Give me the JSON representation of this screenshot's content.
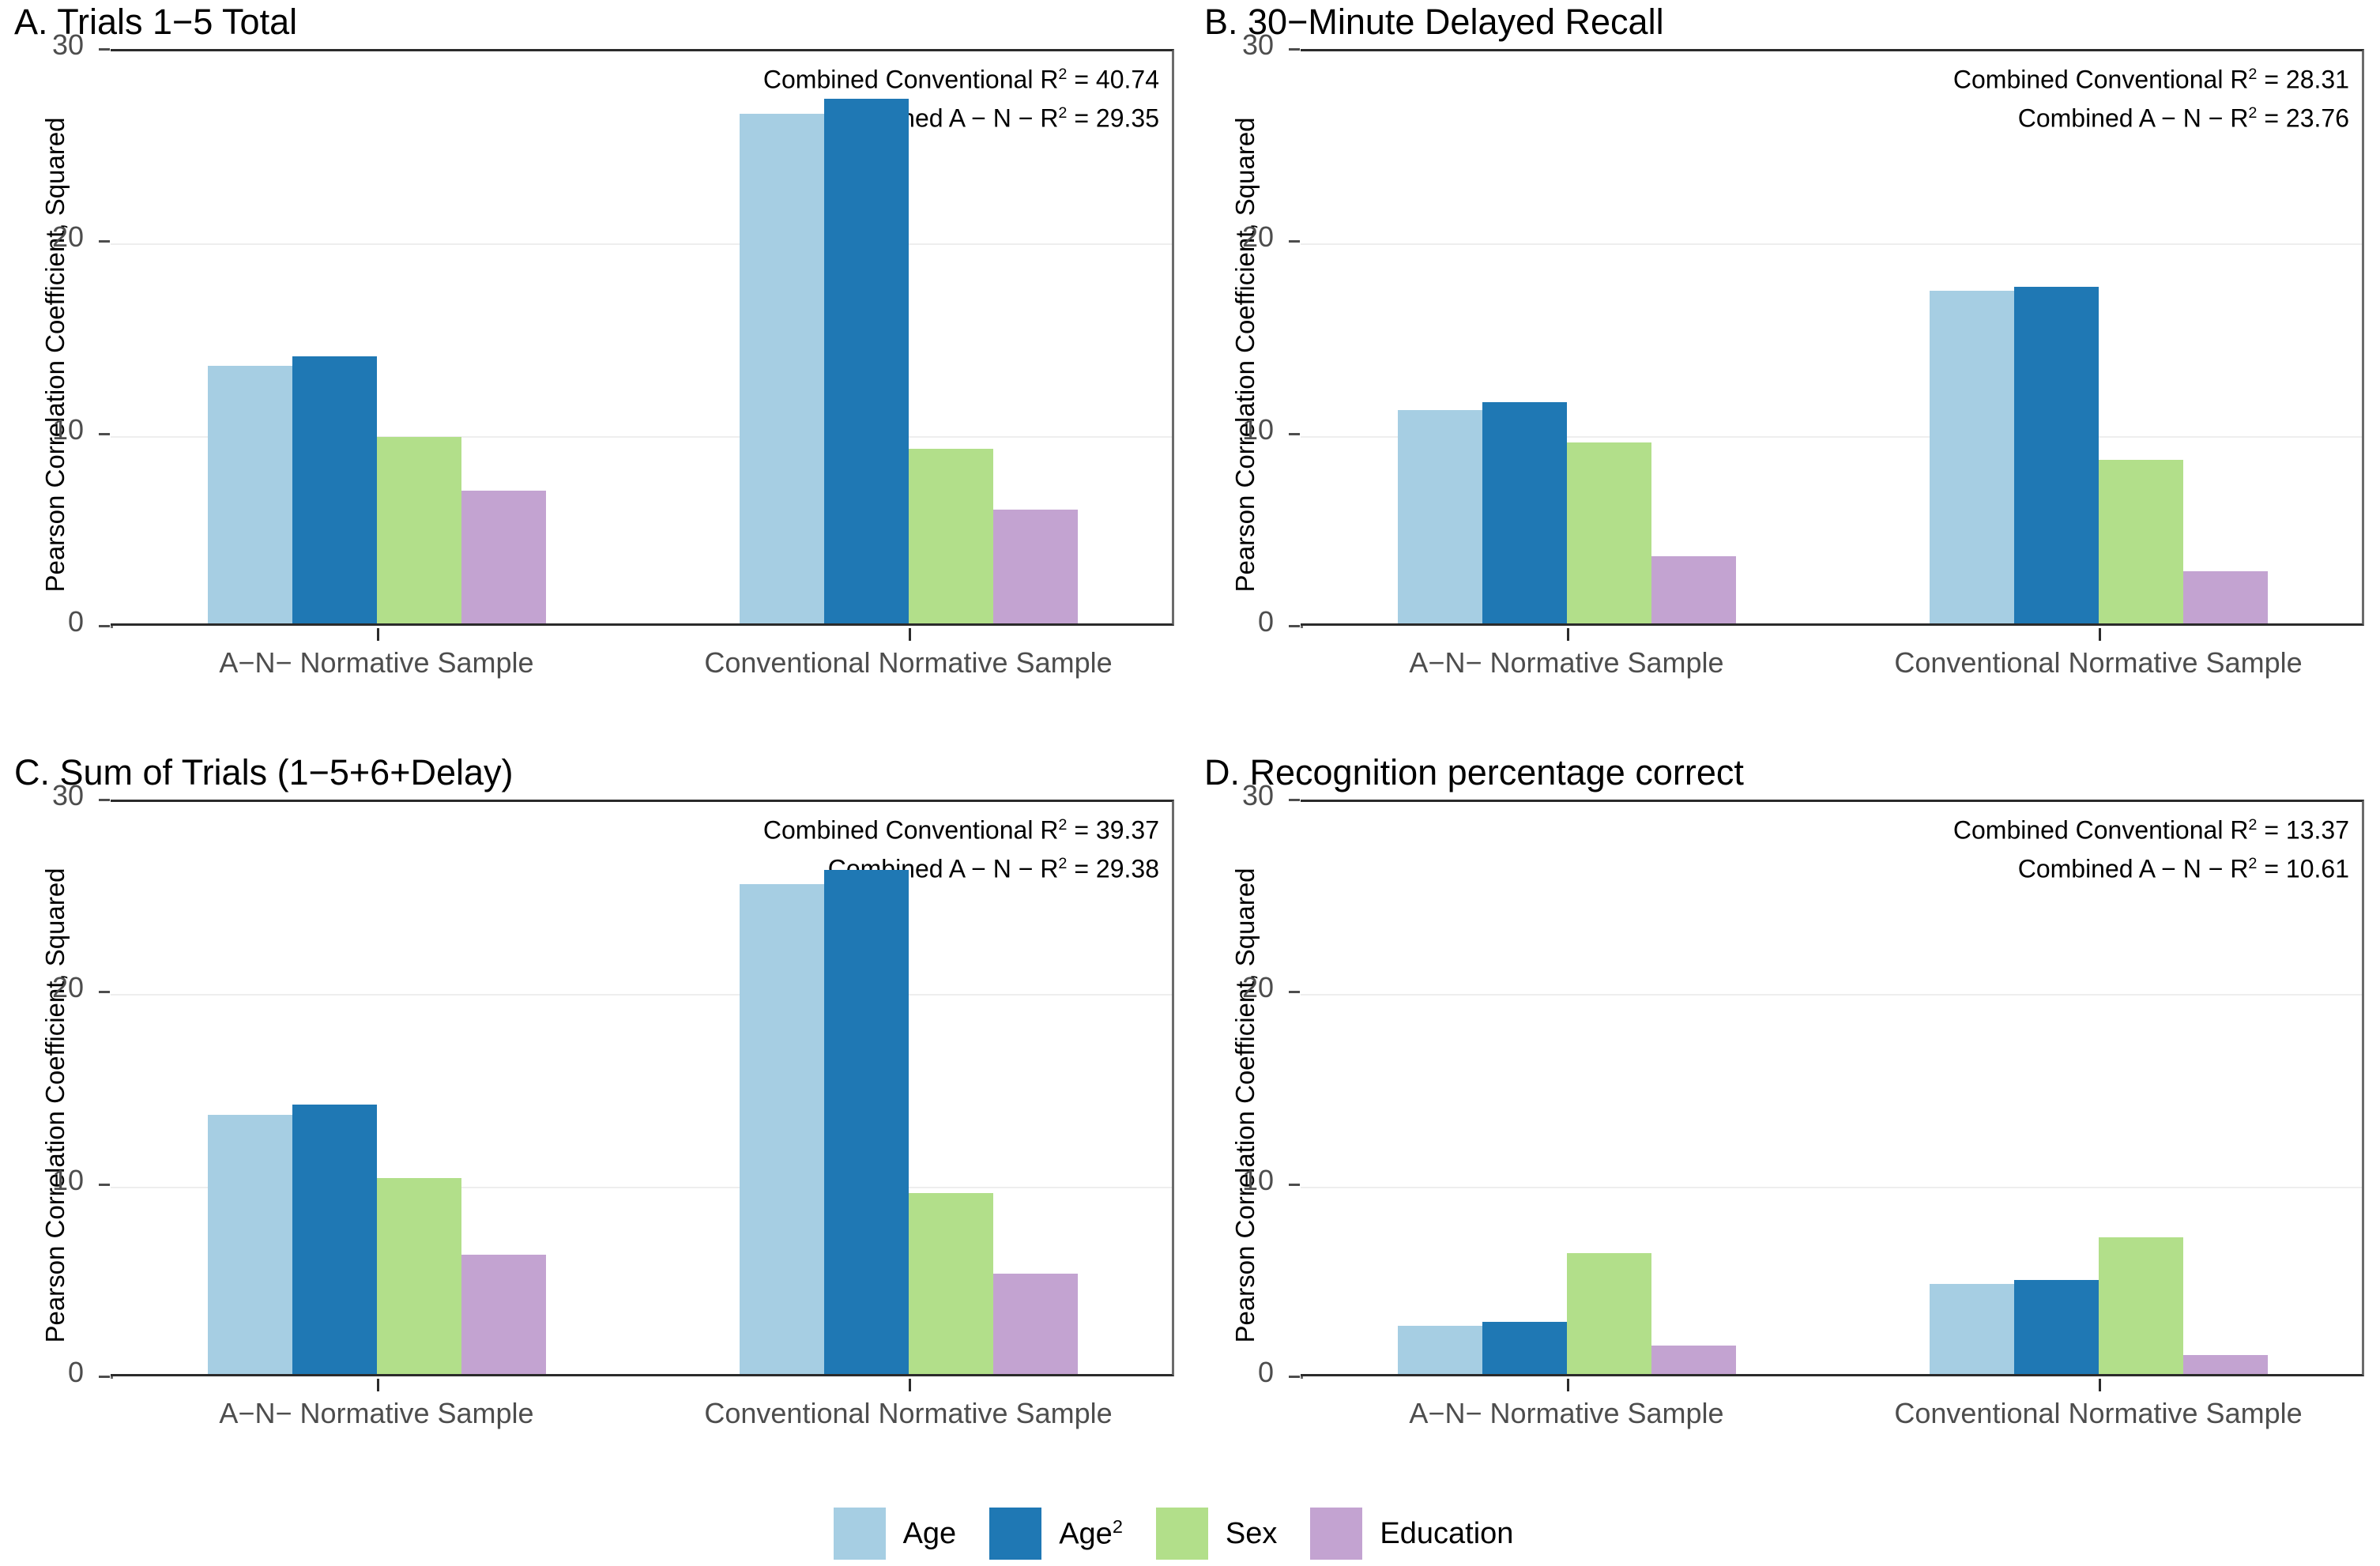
{
  "figure": {
    "ylabel": "Pearson Correlation Coefficient, Squared",
    "y_ticks": [
      "0",
      "10",
      "20",
      "30"
    ],
    "x_ticks": [
      "A−N− Normative Sample",
      "Conventional Normative Sample"
    ]
  },
  "legend": {
    "items": [
      {
        "label": "Age",
        "sup": "",
        "color": "#A6CEE3"
      },
      {
        "label": "Age",
        "sup": "2",
        "color": "#1F78B4"
      },
      {
        "label": "Sex",
        "sup": "",
        "color": "#B2DF8A"
      },
      {
        "label": "Education",
        "sup": "",
        "color": "#C3A3D1"
      }
    ]
  },
  "panels": {
    "A": {
      "title": "A. Trials 1−5 Total",
      "annotation_line1_prefix": "Combined Conventional R",
      "annotation_line1_value": " = 40.74",
      "annotation_line2_prefix": "Combined A − N −  R",
      "annotation_line2_value": " = 29.35"
    },
    "B": {
      "title": "B. 30−Minute Delayed Recall",
      "annotation_line1_prefix": "Combined Conventional R",
      "annotation_line1_value": " = 28.31",
      "annotation_line2_prefix": "Combined A − N −  R",
      "annotation_line2_value": " = 23.76"
    },
    "C": {
      "title": "C. Sum of Trials (1−5+6+Delay)",
      "annotation_line1_prefix": "Combined Conventional R",
      "annotation_line1_value": " = 39.37",
      "annotation_line2_prefix": "Combined A − N −  R",
      "annotation_line2_value": " = 29.38"
    },
    "D": {
      "title": "D. Recognition percentage correct",
      "annotation_line1_prefix": "Combined Conventional R",
      "annotation_line1_value": " = 13.37",
      "annotation_line2_prefix": "Combined A − N −  R",
      "annotation_line2_value": " = 10.61"
    }
  },
  "chart_data": [
    {
      "panel": "A",
      "type": "bar",
      "title": "A. Trials 1−5 Total",
      "xlabel": "",
      "ylabel": "Pearson Correlation Coefficient, Squared",
      "ylim": [
        0,
        30
      ],
      "yticks": [
        0,
        10,
        20,
        30
      ],
      "grid": true,
      "legend_position": "bottom",
      "categories": [
        "A−N− Normative Sample",
        "Conventional Normative Sample"
      ],
      "series": [
        {
          "name": "Age",
          "color": "#A6CEE3",
          "values": [
            13.4,
            26.5
          ]
        },
        {
          "name": "Age²",
          "color": "#1F78B4",
          "values": [
            13.9,
            27.3
          ]
        },
        {
          "name": "Sex",
          "color": "#B2DF8A",
          "values": [
            9.7,
            9.1
          ]
        },
        {
          "name": "Education",
          "color": "#C3A3D1",
          "values": [
            6.9,
            5.9
          ]
        }
      ],
      "annotations": [
        "Combined Conventional R² = 40.74",
        "Combined A − N −  R² = 29.35"
      ]
    },
    {
      "panel": "B",
      "type": "bar",
      "title": "B. 30−Minute Delayed Recall",
      "xlabel": "",
      "ylabel": "Pearson Correlation Coefficient, Squared",
      "ylim": [
        0,
        30
      ],
      "yticks": [
        0,
        10,
        20,
        30
      ],
      "grid": true,
      "legend_position": "bottom",
      "categories": [
        "A−N− Normative Sample",
        "Conventional Normative Sample"
      ],
      "series": [
        {
          "name": "Age",
          "color": "#A6CEE3",
          "values": [
            11.1,
            17.3
          ]
        },
        {
          "name": "Age²",
          "color": "#1F78B4",
          "values": [
            11.5,
            17.5
          ]
        },
        {
          "name": "Sex",
          "color": "#B2DF8A",
          "values": [
            9.4,
            8.5
          ]
        },
        {
          "name": "Education",
          "color": "#C3A3D1",
          "values": [
            3.5,
            2.7
          ]
        }
      ],
      "annotations": [
        "Combined Conventional R² = 28.31",
        "Combined A − N −  R² = 23.76"
      ]
    },
    {
      "panel": "C",
      "type": "bar",
      "title": "C. Sum of Trials (1−5+6+Delay)",
      "xlabel": "",
      "ylabel": "Pearson Correlation Coefficient, Squared",
      "ylim": [
        0,
        30
      ],
      "yticks": [
        0,
        10,
        20,
        30
      ],
      "grid": true,
      "legend_position": "bottom",
      "categories": [
        "A−N− Normative Sample",
        "Conventional Normative Sample"
      ],
      "series": [
        {
          "name": "Age",
          "color": "#A6CEE3",
          "values": [
            13.5,
            25.5
          ]
        },
        {
          "name": "Age²",
          "color": "#1F78B4",
          "values": [
            14.0,
            26.2
          ]
        },
        {
          "name": "Sex",
          "color": "#B2DF8A",
          "values": [
            10.2,
            9.4
          ]
        },
        {
          "name": "Education",
          "color": "#C3A3D1",
          "values": [
            6.2,
            5.2
          ]
        }
      ],
      "annotations": [
        "Combined Conventional R² = 39.37",
        "Combined A − N −  R² = 29.38"
      ]
    },
    {
      "panel": "D",
      "type": "bar",
      "title": "D. Recognition percentage correct",
      "xlabel": "",
      "ylabel": "Pearson Correlation Coefficient, Squared",
      "ylim": [
        0,
        30
      ],
      "yticks": [
        0,
        10,
        20,
        30
      ],
      "grid": true,
      "legend_position": "bottom",
      "categories": [
        "A−N− Normative Sample",
        "Conventional Normative Sample"
      ],
      "series": [
        {
          "name": "Age",
          "color": "#A6CEE3",
          "values": [
            2.5,
            4.7
          ]
        },
        {
          "name": "Age²",
          "color": "#1F78B4",
          "values": [
            2.7,
            4.9
          ]
        },
        {
          "name": "Sex",
          "color": "#B2DF8A",
          "values": [
            6.3,
            7.1
          ]
        },
        {
          "name": "Education",
          "color": "#C3A3D1",
          "values": [
            1.5,
            1.0
          ]
        }
      ],
      "annotations": [
        "Combined Conventional R² = 13.37",
        "Combined A − N −  R² = 10.61"
      ]
    }
  ]
}
